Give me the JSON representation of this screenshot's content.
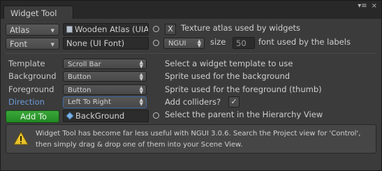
{
  "window": {
    "tab_title": "Widget Tool",
    "menu_icon": "options-icon",
    "close_icon": "close-icon"
  },
  "atlas": {
    "button_label": "Atlas",
    "value": "Wooden Atlas (UIA",
    "clear_label": "X",
    "description": "Texture atlas used by widgets"
  },
  "font": {
    "button_label": "Font",
    "value": "None (UI Font)",
    "type_value": "NGUI",
    "size_label": "size",
    "size_value": "50",
    "description": "font used by the labels"
  },
  "template": {
    "label": "Template",
    "value": "Scroll Bar",
    "description": "Select a widget template to use"
  },
  "background": {
    "label": "Background",
    "value": "Button",
    "description": "Sprite used for the background"
  },
  "foreground": {
    "label": "Foreground",
    "value": "Button",
    "description": "Sprite used for the foreground (thumb)"
  },
  "direction": {
    "label": "Direction",
    "value": "Left To Right",
    "description": "Add colliders?",
    "collider_check": "✓"
  },
  "add_to": {
    "button_label": "Add To",
    "value": "BackGround",
    "description": "Select the parent in the Hierarchy View"
  },
  "warning": {
    "line1": "Widget Tool has become far less useful with NGUI 3.0.6. Search the Project view for 'Control',",
    "line2": "then simply drag & drop one of them into your Scene View."
  },
  "colors": {
    "accent_blue": "#6c9bd8",
    "add_to_green": "#2f9a2f",
    "warning_yellow": "#e8c22a"
  }
}
